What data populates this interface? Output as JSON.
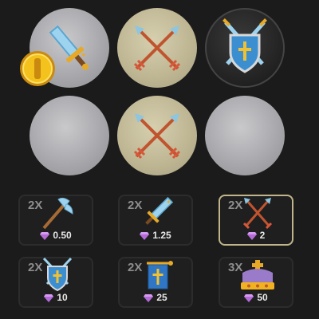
{
  "tiles": [
    {
      "name": "sword",
      "style": "silver"
    },
    {
      "name": "crossed-arrows",
      "style": "olive"
    },
    {
      "name": "shield-swords",
      "style": "dark"
    },
    {
      "name": "blank",
      "style": "silver"
    },
    {
      "name": "crossed-arrows",
      "style": "olive"
    },
    {
      "name": "blank",
      "style": "silver"
    }
  ],
  "coin_icon": "gold-coin-icon",
  "prizes": [
    {
      "multiplier": "2X",
      "icon": "axe-icon",
      "price": "0.50"
    },
    {
      "multiplier": "2X",
      "icon": "sword-icon",
      "price": "1.25"
    },
    {
      "multiplier": "2X",
      "icon": "crossed-arrows-icon",
      "price": "2",
      "selected": true
    },
    {
      "multiplier": "2X",
      "icon": "shield-swords-icon",
      "price": "10"
    },
    {
      "multiplier": "2X",
      "icon": "banner-icon",
      "price": "25"
    },
    {
      "multiplier": "3X",
      "icon": "crown-icon",
      "price": "50"
    }
  ],
  "colors": {
    "background": "#1b1b1b",
    "gem": "#b36bd6",
    "selected_border": "#c2b48a"
  }
}
